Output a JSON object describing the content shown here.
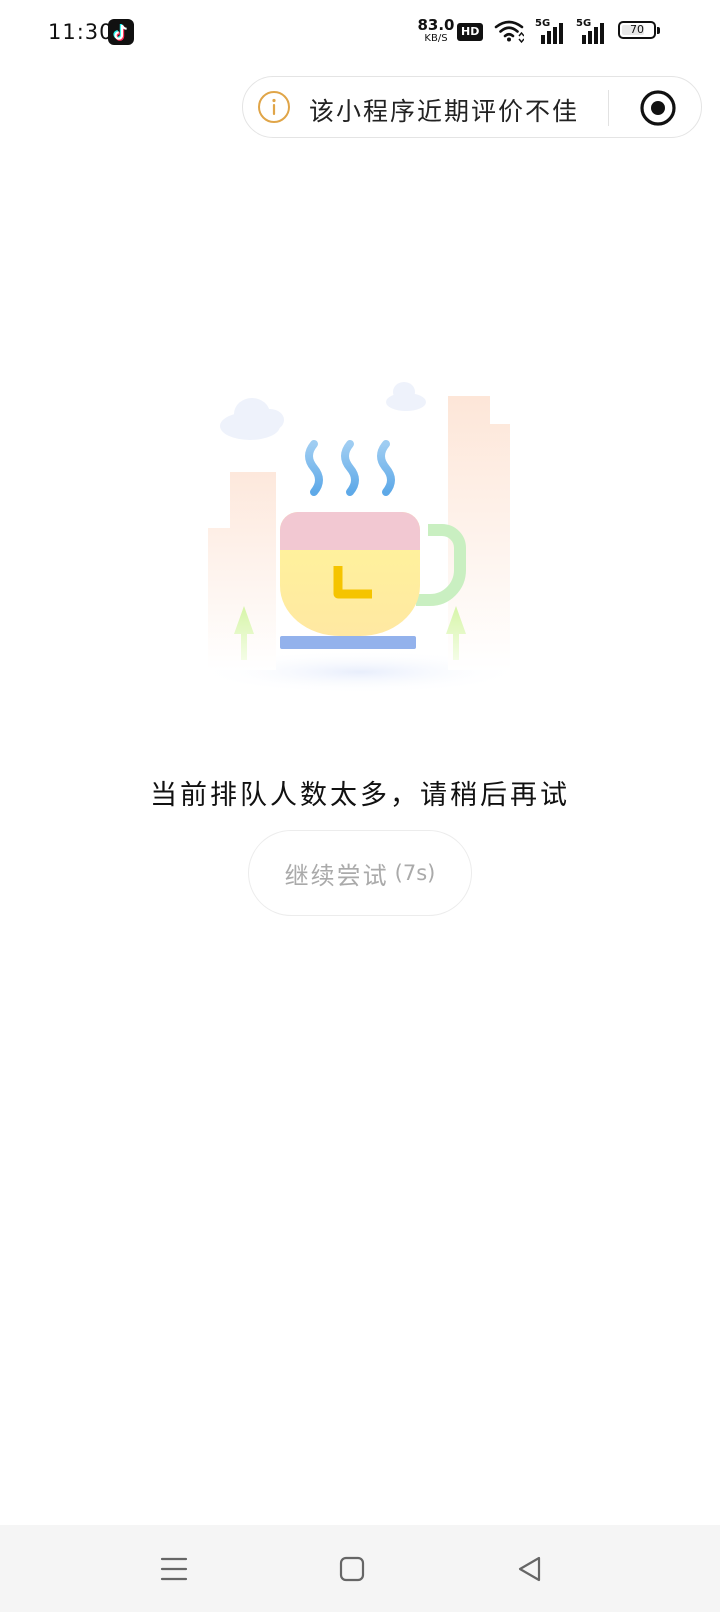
{
  "status_bar": {
    "time": "11:30",
    "net_speed_value": "83.0",
    "net_speed_unit": "KB/S",
    "hd_badge": "HD",
    "network_1": "5G",
    "network_2": "5G",
    "battery_level": "70",
    "app_icon": "tiktok-icon"
  },
  "warning_banner": {
    "text": "该小程序近期评价不佳",
    "info_icon": "info-icon",
    "close_icon": "record-close-icon",
    "accent_color": "#e0a548"
  },
  "main": {
    "message": "当前排队人数太多，请稍后再试",
    "retry_label": "继续尝试",
    "retry_countdown": "(7s)"
  },
  "nav_bar": {
    "menu_icon": "menu-icon",
    "home_icon": "home-icon",
    "back_icon": "back-icon"
  }
}
